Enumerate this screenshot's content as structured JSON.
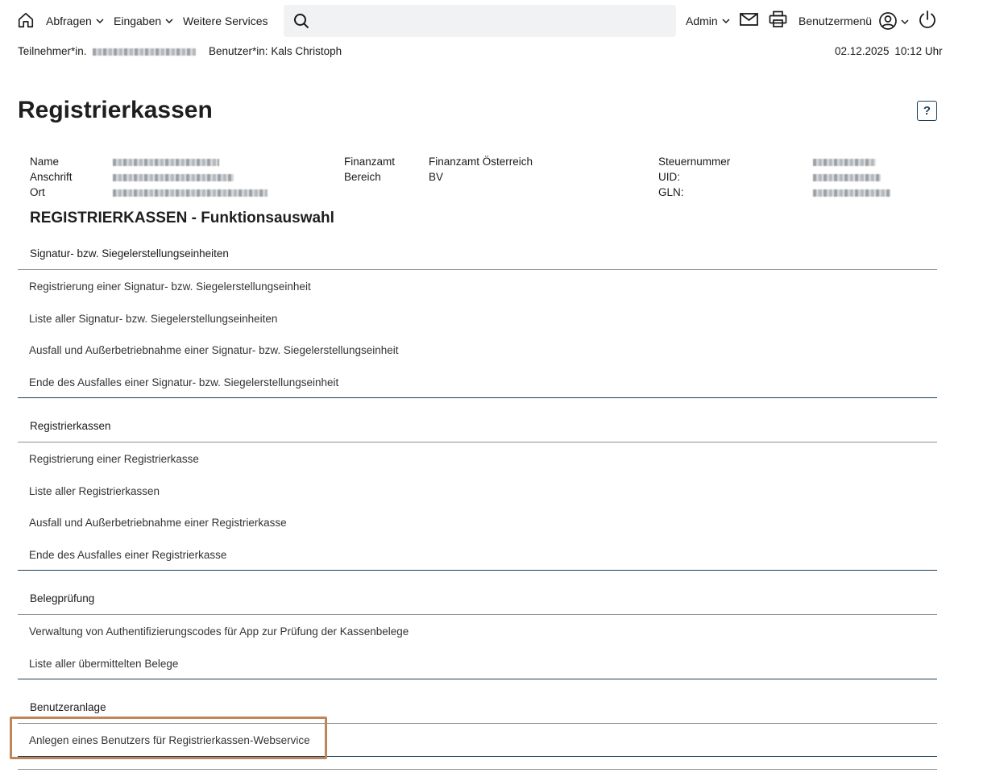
{
  "nav": {
    "abfragen": "Abfragen",
    "eingaben": "Eingaben",
    "weitere": "Weitere Services",
    "search_placeholder": "",
    "admin": "Admin",
    "benutzermenue": "Benutzermenü"
  },
  "subheader": {
    "teilnehmer_label": "Teilnehmer*in.",
    "benutzer_label": "Benutzer*in:",
    "benutzer_value": "Kals Christoph",
    "date": "02.12.2025",
    "time": "10:12 Uhr"
  },
  "page": {
    "title": "Registrierkassen",
    "help": "?"
  },
  "info": {
    "name_label": "Name",
    "anschrift_label": "Anschrift",
    "ort_label": "Ort",
    "finanzamt_label": "Finanzamt",
    "finanzamt_value": "Finanzamt Österreich",
    "bereich_label": "Bereich",
    "bereich_value": "BV",
    "steuernummer_label": "Steuernummer",
    "uid_label": "UID:",
    "gln_label": "GLN:"
  },
  "section_title": "REGISTRIERKASSEN - Funktionsauswahl",
  "groups": [
    {
      "title": "Signatur- bzw. Siegelerstellungseinheiten",
      "links": [
        "Registrierung einer Signatur- bzw. Siegelerstellungseinheit",
        "Liste aller Signatur- bzw. Siegelerstellungseinheiten",
        "Ausfall und Außerbetriebnahme einer Signatur- bzw. Siegelerstellungseinheit",
        "Ende des Ausfalles einer Signatur- bzw. Siegelerstellungseinheit"
      ]
    },
    {
      "title": "Registrierkassen",
      "links": [
        "Registrierung einer Registrierkasse",
        "Liste aller Registrierkassen",
        "Ausfall und Außerbetriebnahme einer Registrierkasse",
        "Ende des Ausfalles einer Registrierkasse"
      ]
    },
    {
      "title": "Belegprüfung",
      "links": [
        "Verwaltung von Authentifizierungscodes für App zur Prüfung der Kassenbelege",
        "Liste aller übermittelten Belege"
      ]
    },
    {
      "title": "Benutzeranlage",
      "links": [
        "Anlegen eines Benutzers für Registrierkassen-Webservice"
      ]
    }
  ],
  "colors": {
    "accent": "#1e3e5a",
    "highlight": "#c0855a",
    "search_bg": "#f0f2f4"
  }
}
